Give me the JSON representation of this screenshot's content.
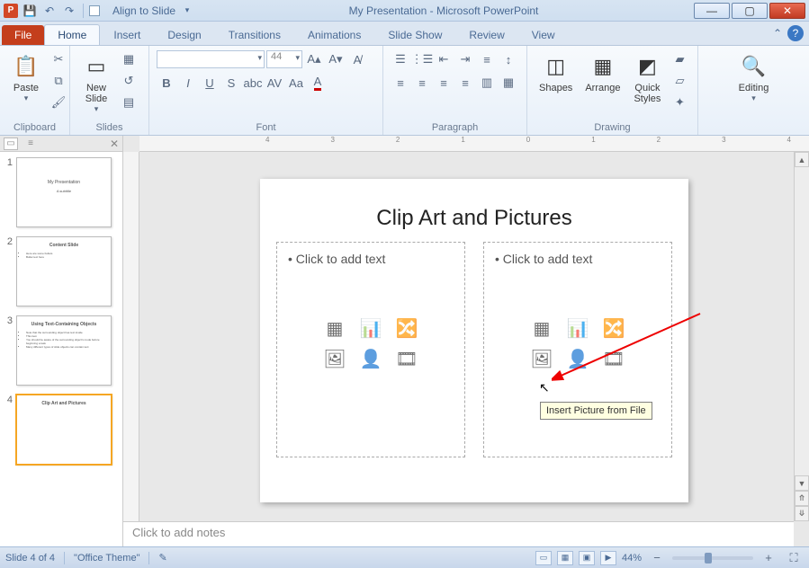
{
  "titlebar": {
    "align_label": "Align to Slide",
    "title": "My Presentation - Microsoft PowerPoint"
  },
  "tabs": {
    "file": "File",
    "home": "Home",
    "insert": "Insert",
    "design": "Design",
    "transitions": "Transitions",
    "animations": "Animations",
    "slideshow": "Slide Show",
    "review": "Review",
    "view": "View"
  },
  "ribbon": {
    "clipboard": {
      "label": "Clipboard",
      "paste": "Paste"
    },
    "slides": {
      "label": "Slides",
      "new_slide": "New\nSlide"
    },
    "font": {
      "label": "Font",
      "size": "44"
    },
    "paragraph": {
      "label": "Paragraph"
    },
    "drawing": {
      "label": "Drawing",
      "shapes": "Shapes",
      "arrange": "Arrange",
      "quick": "Quick\nStyles"
    },
    "editing": {
      "label": "Editing",
      "editing_btn": "Editing"
    }
  },
  "thumbs": [
    {
      "num": "1",
      "title": "My Presentation",
      "sub": "A subtitle"
    },
    {
      "num": "2",
      "title": "Content Slide",
      "bullets": [
        "Here are some bullets",
        "Bullet text here"
      ]
    },
    {
      "num": "3",
      "title": "Using Text-Containing Objects",
      "bullets": [
        "Note that the surrounding object has text inside",
        "This item",
        "You should be aware of the surrounding object's mode before beginning a task",
        "Many different types of slide objects can contain text"
      ]
    },
    {
      "num": "4",
      "title": "Clip Art and Pictures"
    }
  ],
  "slide": {
    "title": "Clip Art and Pictures",
    "placeholder_text": "Click to add text",
    "tooltip": "Insert Picture from File"
  },
  "ruler_ticks": [
    "4",
    "3",
    "2",
    "1",
    "0",
    "1",
    "2",
    "3",
    "4"
  ],
  "notes": {
    "placeholder": "Click to add notes"
  },
  "status": {
    "slide_info": "Slide 4 of 4",
    "theme": "\"Office Theme\"",
    "zoom": "44%"
  }
}
